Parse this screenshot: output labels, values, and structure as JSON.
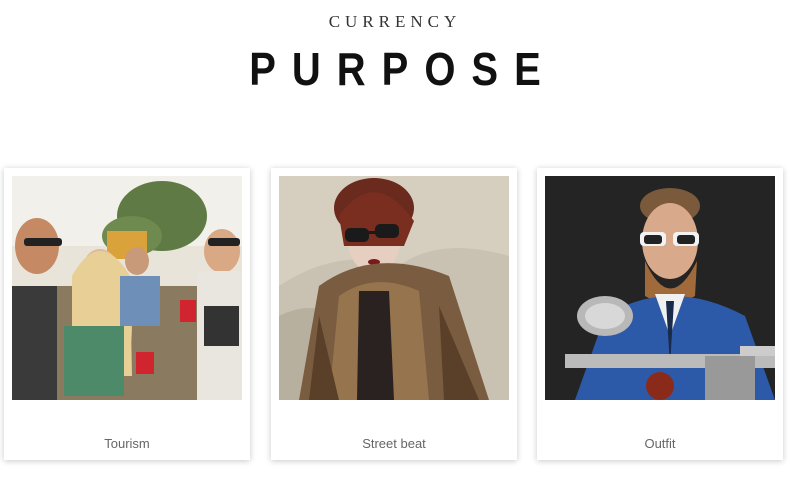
{
  "header": {
    "subtitle": "CURRENCY",
    "title": "PURPOSE"
  },
  "cards": [
    {
      "caption": "Tourism"
    },
    {
      "caption": "Street beat"
    },
    {
      "caption": "Outfit"
    }
  ]
}
